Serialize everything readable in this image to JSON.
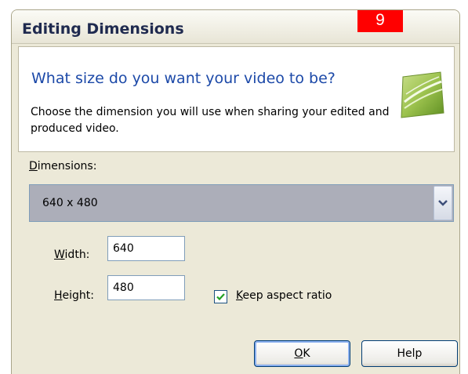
{
  "window": {
    "title": "Editing Dimensions",
    "step_badge": "9"
  },
  "header": {
    "heading": "What size do you want your video to be?",
    "description": "Choose the dimension you will use when sharing your edited and produced video.",
    "icon": "green-swoosh-logo-icon"
  },
  "dimensions": {
    "label_mnemonic": "D",
    "label_rest": "imensions:",
    "selected_value": "640 x 480"
  },
  "width": {
    "label_mnemonic": "W",
    "label_rest": "idth:",
    "value": "640"
  },
  "height": {
    "label_mnemonic": "H",
    "label_rest": "eight:",
    "value": "480"
  },
  "aspect": {
    "label_mnemonic": "K",
    "label_rest": "eep aspect ratio",
    "checked": true
  },
  "buttons": {
    "ok_mnemonic": "O",
    "ok_rest": "K",
    "help_label": "Help"
  },
  "colors": {
    "heading": "#1c49a8",
    "dialog_bg": "#ece9d8",
    "select_bg": "#acaeb9",
    "badge": "#ff0000"
  }
}
